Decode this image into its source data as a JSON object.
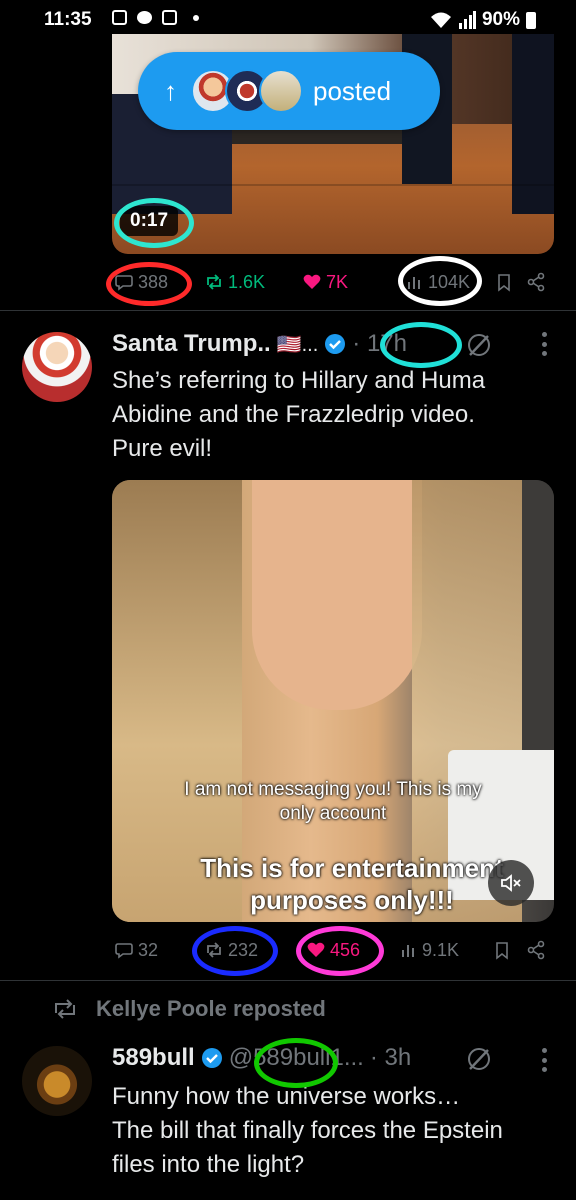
{
  "status_bar": {
    "time": "11:35",
    "battery": "90%"
  },
  "top_post": {
    "duration": "0:17",
    "posted_pill": {
      "label": "posted"
    },
    "stats": {
      "replies": "388",
      "reposts": "1.6K",
      "likes": "7K",
      "views": "104K"
    }
  },
  "tweet1": {
    "name": "Santa Trump..",
    "flag": "🇺🇸...",
    "time": "· 17h",
    "text_lines": [
      "She’s referring to Hillary and Huma",
      "Abidine and the Frazzledrip video.",
      "Pure evil!"
    ],
    "video_caption1": [
      "I am not messaging you! This is my",
      "only account"
    ],
    "video_caption2": [
      "This is for entertainment",
      "purposes only!!!"
    ],
    "stats": {
      "replies": "32",
      "reposts": "232",
      "likes": "456",
      "views": "9.1K"
    }
  },
  "tweet2": {
    "repost_label": "Kellye Poole reposted",
    "name": "589bull",
    "handle": "@589bull1...",
    "time": "· 3h",
    "text_lines": [
      "Funny how the universe works…",
      "The bill that finally forces the Epstein",
      "files into the light?"
    ]
  },
  "colors": {
    "background": "#000000",
    "text": "#e7e9ea",
    "muted": "#71767b",
    "accent": "#1d9bf0",
    "repost_green": "#00ba7c",
    "like_pink": "#f91880"
  },
  "annotation_ring_colors": [
    "#2ee6d0",
    "#ff2a2a",
    "#ffffff",
    "#20e0d8",
    "#1a2bff",
    "#ff3ad8",
    "#11c800"
  ]
}
